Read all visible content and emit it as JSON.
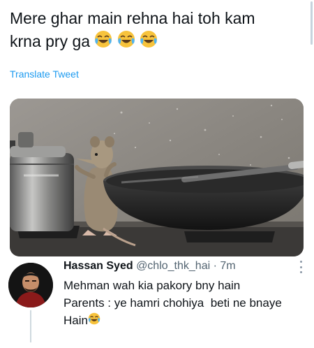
{
  "tweet": {
    "line1": "Mere ghar main rehna hai toh kam",
    "line2": "krna pry ga",
    "emoji_icon": "face-with-tears-of-joy-icon",
    "emoji_count": 3,
    "translate_label": "Translate Tweet"
  },
  "media": {
    "icon": "mouse-cooking-photo"
  },
  "reply": {
    "name": "Hassan Syed",
    "handle": "@chlo_thk_hai",
    "separator": "·",
    "time": "7m",
    "lines": [
      "Mehman wah kia pakory bny hain",
      "Parents : ye hamri chohiya  beti ne bnaye",
      "Hain"
    ],
    "emoji_icon": "face-with-tears-of-joy-icon"
  },
  "colors": {
    "link": "#1d9bf0",
    "secondary_text": "#536471",
    "primary_text": "#0f1419"
  }
}
